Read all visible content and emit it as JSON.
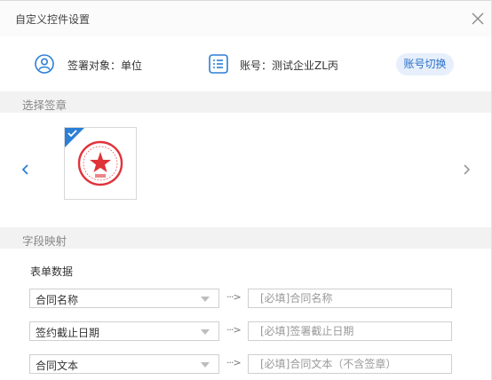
{
  "window": {
    "title": "自定义控件设置",
    "close_icon": "close-icon"
  },
  "signer": {
    "label": "签署对象：单位",
    "icon": "user-circle-icon"
  },
  "account": {
    "label": "账号：测试企业ZL丙",
    "icon": "list-icon",
    "switch_button": "账号切换"
  },
  "seal_section": {
    "heading": "选择签章",
    "selected": true,
    "accent_color": "#2b7fd6",
    "seal_color": "#e0333a"
  },
  "field_section": {
    "heading": "字段映射",
    "sub_label": "表单数据"
  },
  "mappings": [
    {
      "field": "合同名称",
      "arrow": "···>",
      "placeholder": "[必填]合同名称"
    },
    {
      "field": "签约截止日期",
      "arrow": "···>",
      "placeholder": "[必填]签署截止日期"
    },
    {
      "field": "合同文本",
      "arrow": "···>",
      "placeholder": "[必填]合同文本（不含签章）"
    }
  ]
}
